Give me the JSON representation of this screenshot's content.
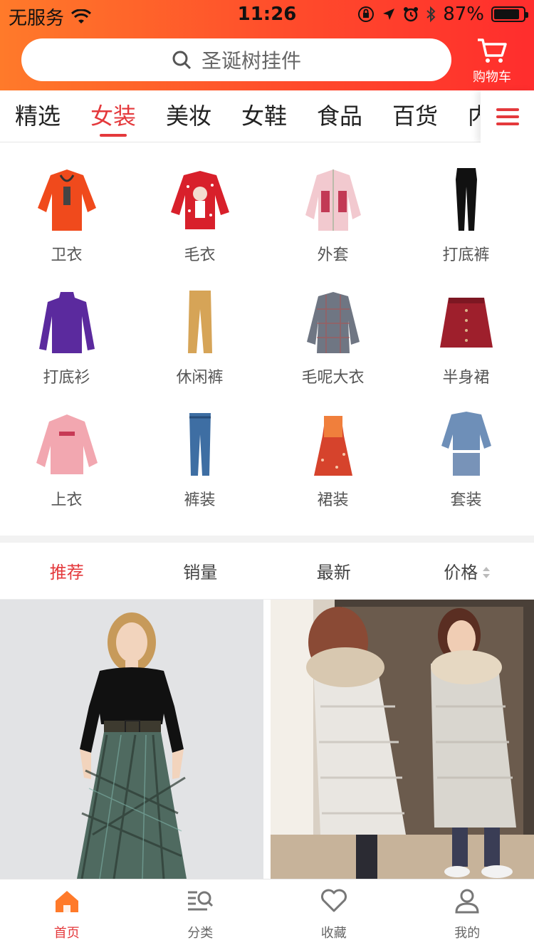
{
  "status": {
    "carrier": "无服务",
    "time": "11:26",
    "battery": "87%",
    "battery_level": 0.87
  },
  "header": {
    "search_placeholder": "圣诞树挂件",
    "cart_label": "购物车"
  },
  "tabs": [
    "精选",
    "女装",
    "美妆",
    "女鞋",
    "食品",
    "百货",
    "内衣"
  ],
  "active_tab": 1,
  "categories": [
    {
      "label": "卫衣",
      "icon": "hoodie"
    },
    {
      "label": "毛衣",
      "icon": "sweater"
    },
    {
      "label": "外套",
      "icon": "jacket"
    },
    {
      "label": "打底裤",
      "icon": "leggings"
    },
    {
      "label": "打底衫",
      "icon": "base-shirt"
    },
    {
      "label": "休闲裤",
      "icon": "casual-pants"
    },
    {
      "label": "毛呢大衣",
      "icon": "wool-coat"
    },
    {
      "label": "半身裙",
      "icon": "skirt"
    },
    {
      "label": "上衣",
      "icon": "top"
    },
    {
      "label": "裤装",
      "icon": "jeans"
    },
    {
      "label": "裙装",
      "icon": "dress"
    },
    {
      "label": "套装",
      "icon": "suit"
    }
  ],
  "sort": {
    "items": [
      "推荐",
      "销量",
      "最新",
      "价格"
    ],
    "active": 0
  },
  "products": [
    {
      "image": "woman in black top and plaid skirt"
    },
    {
      "image": "two women in puffer coats"
    }
  ],
  "bottom_nav": [
    {
      "label": "首页",
      "icon": "home-icon"
    },
    {
      "label": "分类",
      "icon": "category-icon"
    },
    {
      "label": "收藏",
      "icon": "heart-icon"
    },
    {
      "label": "我的",
      "icon": "user-icon"
    }
  ],
  "bottom_nav_active": 0,
  "colors": {
    "accent": "#e4393c",
    "header_start": "#ff7a2a",
    "header_end": "#ff2d2d"
  }
}
